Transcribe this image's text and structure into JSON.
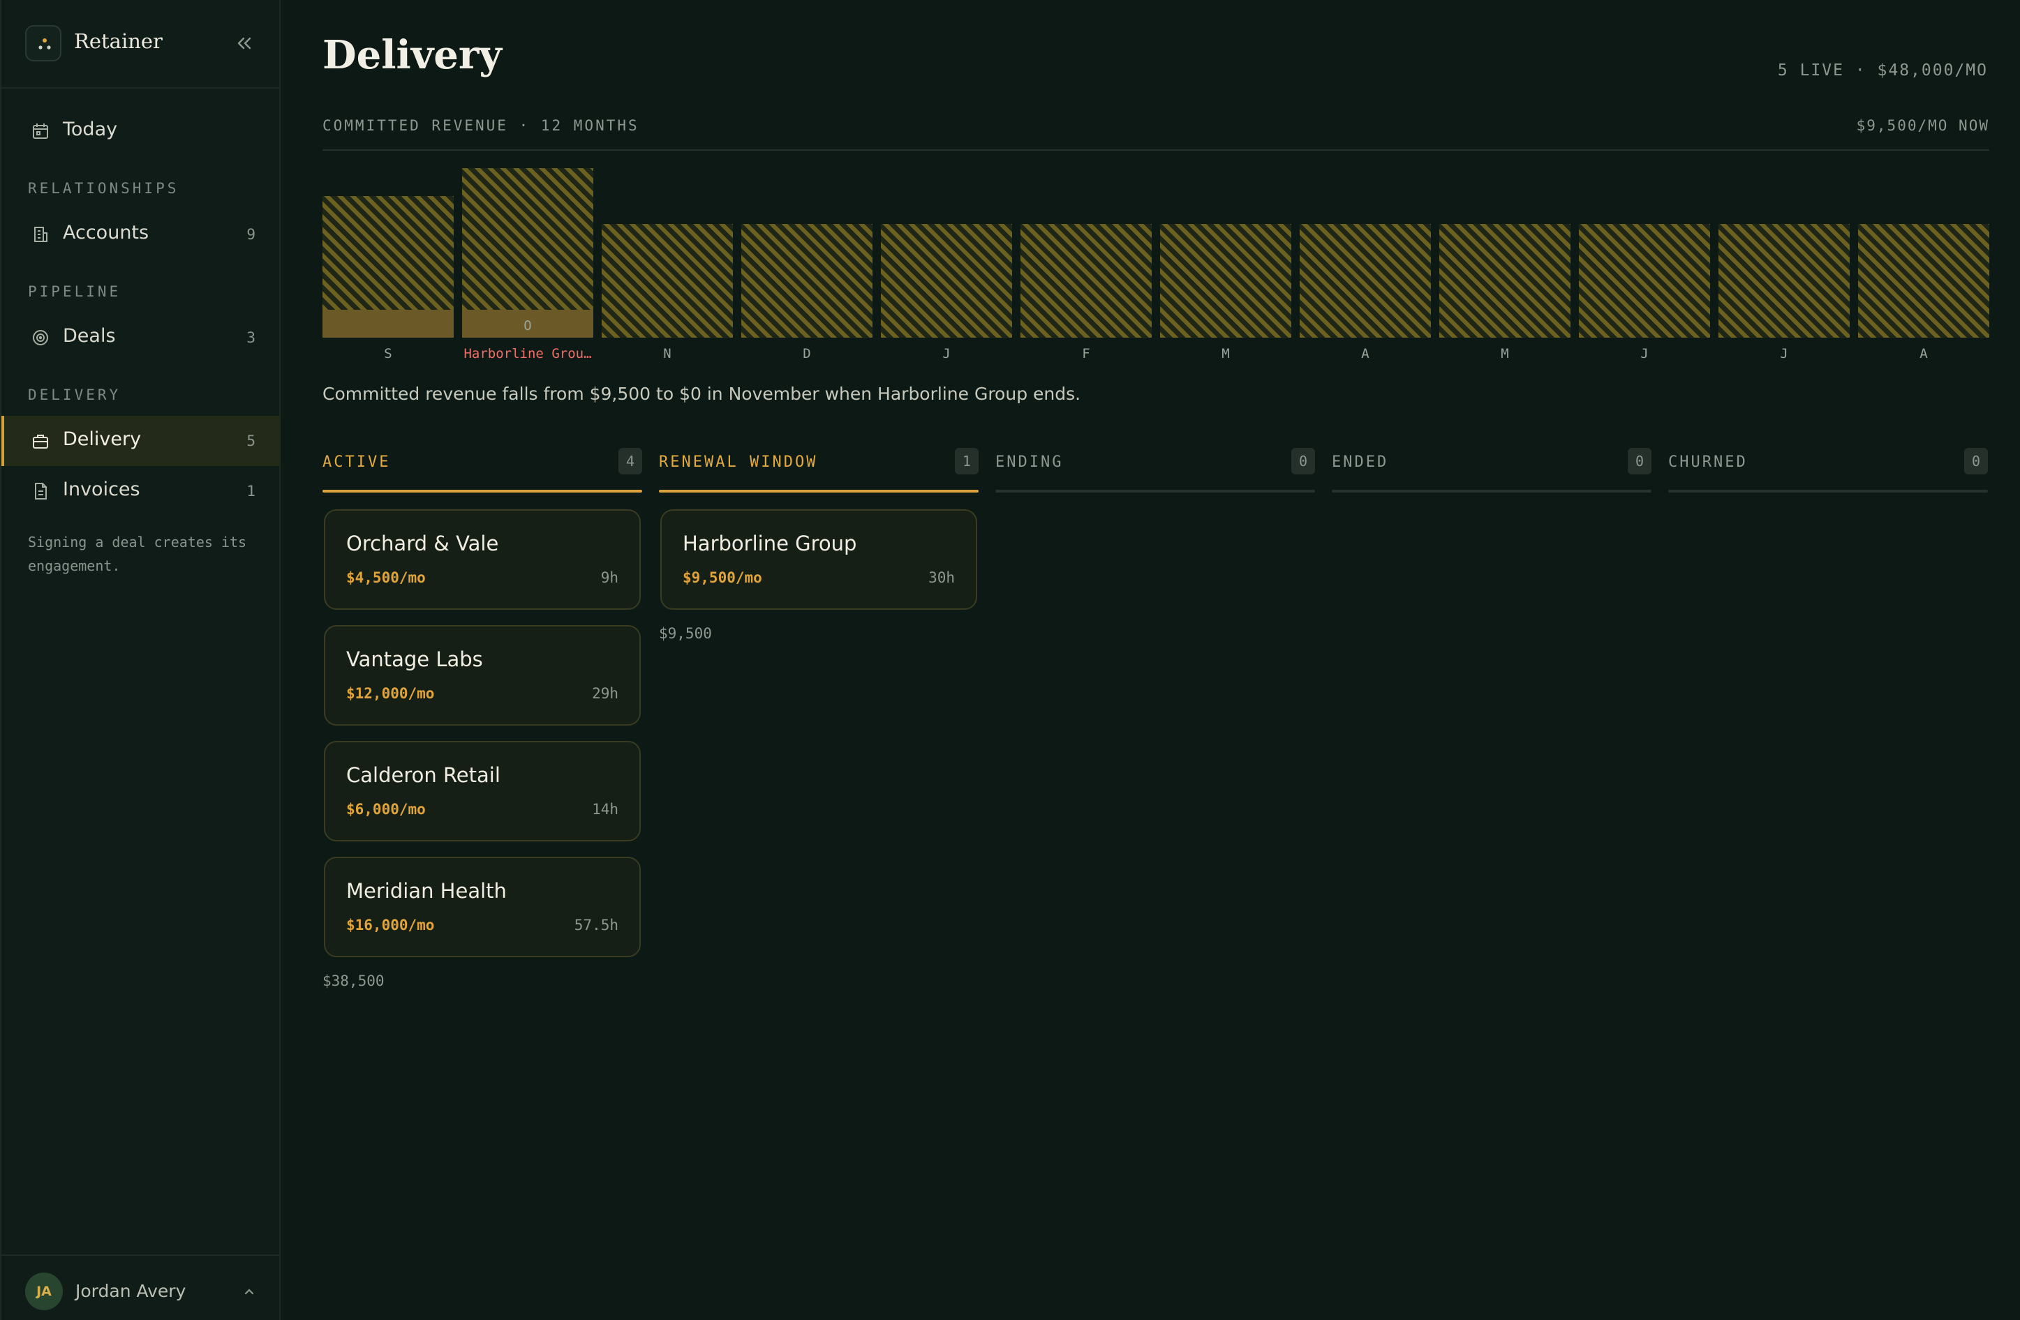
{
  "app": {
    "name": "Retainer"
  },
  "sidebar": {
    "today": {
      "label": "Today"
    },
    "sections": [
      {
        "label": "RELATIONSHIPS",
        "items": [
          {
            "label": "Accounts",
            "count": "9"
          }
        ]
      },
      {
        "label": "PIPELINE",
        "items": [
          {
            "label": "Deals",
            "count": "3"
          }
        ]
      },
      {
        "label": "DELIVERY",
        "items": [
          {
            "label": "Delivery",
            "count": "5",
            "active": true
          },
          {
            "label": "Invoices",
            "count": "1"
          }
        ]
      }
    ],
    "note": "Signing a deal creates its engagement.",
    "user": {
      "initials": "JA",
      "name": "Jordan Avery"
    }
  },
  "page": {
    "title": "Delivery",
    "summary": "5 LIVE · $48,000/MO"
  },
  "chart_header": {
    "title": "COMMITTED REVENUE · 12 MONTHS",
    "now": "$9,500/MO NOW"
  },
  "chart_data": {
    "type": "bar",
    "categories": [
      "S",
      "Harborline Grou…",
      "N",
      "D",
      "J",
      "F",
      "M",
      "A",
      "M",
      "J",
      "J",
      "A"
    ],
    "value_labels": [
      "",
      "O",
      "",
      "",
      "",
      "",
      "",
      "",
      "",
      "",
      "",
      ""
    ],
    "capacity": [
      48000,
      57500,
      38500,
      38500,
      38500,
      38500,
      38500,
      38500,
      38500,
      38500,
      38500,
      38500
    ],
    "committed": [
      9500,
      9500,
      0,
      0,
      0,
      0,
      0,
      0,
      0,
      0,
      0,
      0
    ],
    "alert_index": 1,
    "ylim": [
      0,
      60000
    ],
    "colors": {
      "hatch": "#6d6120",
      "committed": "#6b5a27",
      "alert": "#f06e66"
    }
  },
  "chart_note": "Committed revenue falls from $9,500 to $0 in November when Harborline Group ends.",
  "board": {
    "columns": [
      {
        "title": "ACTIVE",
        "count": "4",
        "highlight": true,
        "total": "$38,500",
        "cards": [
          {
            "name": "Orchard & Vale",
            "amount": "$4,500/mo",
            "hours": "9h"
          },
          {
            "name": "Vantage Labs",
            "amount": "$12,000/mo",
            "hours": "29h"
          },
          {
            "name": "Calderon Retail",
            "amount": "$6,000/mo",
            "hours": "14h"
          },
          {
            "name": "Meridian Health",
            "amount": "$16,000/mo",
            "hours": "57.5h"
          }
        ]
      },
      {
        "title": "RENEWAL WINDOW",
        "count": "1",
        "highlight": true,
        "total": "$9,500",
        "cards": [
          {
            "name": "Harborline Group",
            "amount": "$9,500/mo",
            "hours": "30h"
          }
        ]
      },
      {
        "title": "ENDING",
        "count": "0",
        "highlight": false,
        "total": "",
        "cards": []
      },
      {
        "title": "ENDED",
        "count": "0",
        "highlight": false,
        "total": "",
        "cards": []
      },
      {
        "title": "CHURNED",
        "count": "0",
        "highlight": false,
        "total": "",
        "cards": []
      }
    ]
  }
}
